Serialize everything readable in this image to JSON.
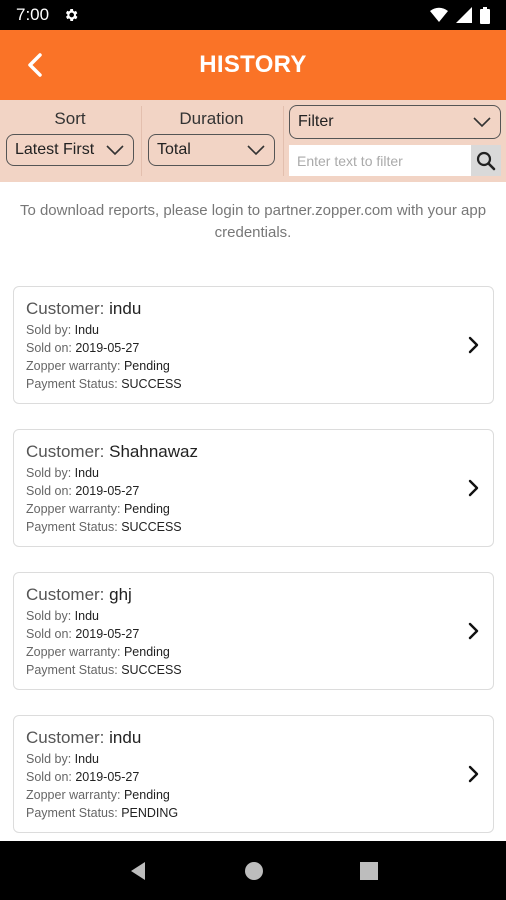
{
  "status_bar": {
    "time": "7:00"
  },
  "app_bar": {
    "title": "HISTORY"
  },
  "controls": {
    "sort_label": "Sort",
    "sort_value": "Latest First",
    "duration_label": "Duration",
    "duration_value": "Total",
    "filter_value": "Filter",
    "filter_placeholder": "Enter text to filter"
  },
  "info_text": "To download reports, please login to partner.zopper.com with your app credentials.",
  "labels": {
    "customer": "Customer: ",
    "sold_by": "Sold by: ",
    "sold_on": "Sold on: ",
    "warranty": "Zopper warranty: ",
    "payment": "Payment Status: "
  },
  "records": [
    {
      "customer": "indu",
      "sold_by": "Indu",
      "sold_on": "2019-05-27",
      "warranty": "Pending",
      "payment": "SUCCESS"
    },
    {
      "customer": "Shahnawaz",
      "sold_by": "Indu",
      "sold_on": "2019-05-27",
      "warranty": "Pending",
      "payment": "SUCCESS"
    },
    {
      "customer": "ghj",
      "sold_by": "Indu",
      "sold_on": "2019-05-27",
      "warranty": "Pending",
      "payment": "SUCCESS"
    },
    {
      "customer": "indu",
      "sold_by": "Indu",
      "sold_on": "2019-05-27",
      "warranty": "Pending",
      "payment": "PENDING"
    }
  ],
  "colors": {
    "accent": "#fa7327",
    "controls_bg": "#f2d4c5"
  }
}
